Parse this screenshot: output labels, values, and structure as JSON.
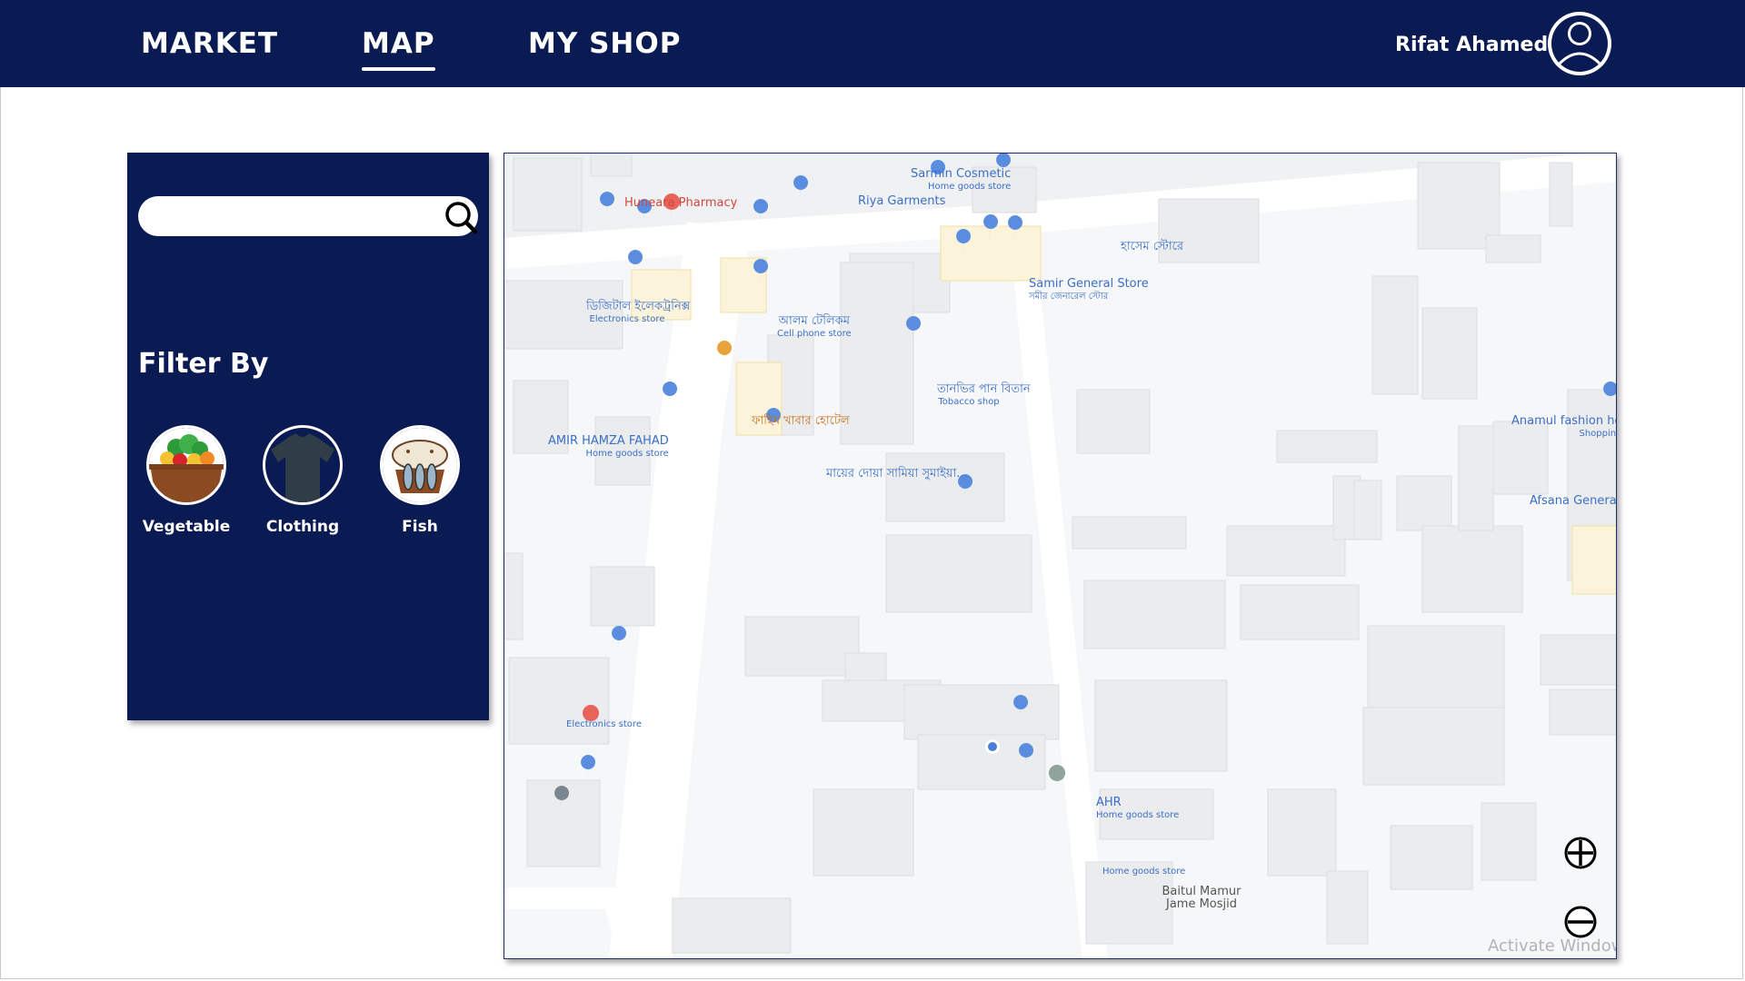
{
  "nav": {
    "items": [
      {
        "label": "MARKET",
        "active": false
      },
      {
        "label": "MAP",
        "active": true
      },
      {
        "label": "MY SHOP",
        "active": false
      }
    ],
    "user_name": "Rifat Ahamed"
  },
  "sidebar": {
    "search_placeholder": "",
    "filter_title": "Filter By",
    "categories": [
      {
        "label": "Vegetable",
        "icon": "vegetable-basket-icon"
      },
      {
        "label": "Clothing",
        "icon": "tshirt-icon"
      },
      {
        "label": "Fish",
        "icon": "fish-basket-icon"
      }
    ]
  },
  "map": {
    "places": [
      {
        "name": "Sarmin Cosmetic",
        "sub": "Home goods store"
      },
      {
        "name": "Riya Garments",
        "sub": ""
      },
      {
        "name": "Huneara Pharmacy",
        "sub": ""
      },
      {
        "name": "হাসেম স্টোরে",
        "sub": ""
      },
      {
        "name": "Samir General Store",
        "sub": "সমীর জেনারেল স্টোর"
      },
      {
        "name": "ডিজিটাল ইলেকট্রনিক্স",
        "sub": "Electronics store"
      },
      {
        "name": "আলম টেলিকম",
        "sub": "Cell phone store"
      },
      {
        "name": "তানভির পান বিতান",
        "sub": "Tobacco shop"
      },
      {
        "name": "ফাহিম খাবার হোটেল",
        "sub": ""
      },
      {
        "name": "AMIR HAMZA FAHAD",
        "sub": "Home goods store"
      },
      {
        "name": "মায়ের দোয়া সামিয়া সুমাইয়া...",
        "sub": ""
      },
      {
        "name": "Anamul fashion ho",
        "sub": "Shopping"
      },
      {
        "name": "Afsana General",
        "sub": ""
      },
      {
        "name": "",
        "sub": "Electronics store"
      },
      {
        "name": "AHR",
        "sub": "Home goods store"
      },
      {
        "name": "",
        "sub": "Home goods store"
      },
      {
        "name": "Baitul Mamur Jame Mosjid",
        "sub": ""
      }
    ],
    "watermark": "Activate Windows",
    "colors": {
      "poi_blue": "#3b6fc7",
      "poi_red": "#d2463c",
      "poi_orange": "#e8a33a"
    }
  },
  "colors": {
    "navy": "#0a1a52",
    "white": "#ffffff"
  }
}
